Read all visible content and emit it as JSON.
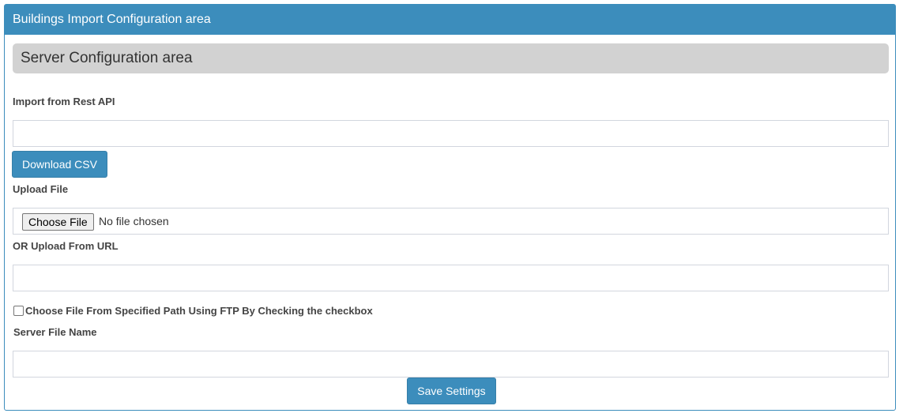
{
  "panel": {
    "title": "Buildings Import Configuration area"
  },
  "section": {
    "title": "Server Configuration area"
  },
  "rest_api": {
    "label": "Import from Rest API",
    "value": "",
    "download_button": "Download CSV"
  },
  "upload_file": {
    "label": "Upload File",
    "choose_button": "Choose File",
    "status": "No file chosen"
  },
  "upload_url": {
    "label": "OR Upload From URL",
    "value": ""
  },
  "ftp": {
    "checkbox_label": "Choose File From Specified Path Using FTP By Checking the checkbox",
    "checked": false
  },
  "server_file": {
    "label": "Server File Name",
    "value": ""
  },
  "save_button": "Save Settings",
  "colors": {
    "primary": "#3c8dbc",
    "section_bg": "#d2d2d2",
    "border": "#d2d6de"
  }
}
